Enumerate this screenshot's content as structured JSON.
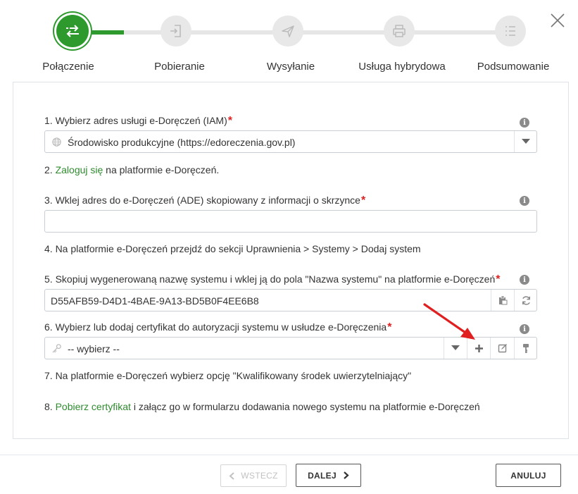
{
  "steps": [
    {
      "label": "Połączenie",
      "icon": "transfer-arrows-icon",
      "active": true
    },
    {
      "label": "Pobieranie",
      "icon": "sign-in-icon",
      "active": false
    },
    {
      "label": "Wysyłanie",
      "icon": "paper-plane-icon",
      "active": false
    },
    {
      "label": "Usługa hybrydowa",
      "icon": "printer-icon",
      "active": false
    },
    {
      "label": "Podsumowanie",
      "icon": "checklist-icon",
      "active": false
    }
  ],
  "form": {
    "step1": {
      "label": "1. Wybierz adres usługi e-Doręczeń (IAM)",
      "required": "*",
      "value": "Środowisko produkcyjne (https://edoreczenia.gov.pl)"
    },
    "step2": {
      "link": "Zaloguj się",
      "text": " na platformie e-Doręczeń.",
      "prefix": "2. "
    },
    "step3": {
      "label": "3. Wklej adres do e-Doręczeń (ADE) skopiowany z informacji o skrzynce",
      "required": "*",
      "value": ""
    },
    "step4": {
      "text": "4. Na platformie e-Doręczeń przejdź do sekcji Uprawnienia > Systemy > Dodaj system"
    },
    "step5": {
      "label": "5. Skopiuj wygenerowaną nazwę systemu i wklej ją do pola \"Nazwa systemu\" na platformie e-Doręczeń",
      "required": "*",
      "value": "D55AFB59-D4D1-4BAE-9A13-BD5B0F4EE6B8"
    },
    "step6": {
      "label": "6. Wybierz lub dodaj certyfikat do autoryzacji systemu w usłudze e-Doręczenia",
      "required": "*",
      "value": "-- wybierz --"
    },
    "step7": {
      "text": "7. Na platformie e-Doręczeń wybierz opcję \"Kwalifikowany środek uwierzytelniający\""
    },
    "step8": {
      "prefix": "8. ",
      "link": "Pobierz certyfikat",
      "text": " i załącz go w formularzu dodawania nowego systemu na platformie e-Doręczeń"
    },
    "info": "i"
  },
  "footer": {
    "back_label": "WSTECZ",
    "next_label": "DALEJ",
    "cancel_label": "ANULUJ"
  },
  "colors": {
    "accent": "#2e9a2e",
    "required": "#e02020",
    "annotation_arrow": "#e02020"
  }
}
